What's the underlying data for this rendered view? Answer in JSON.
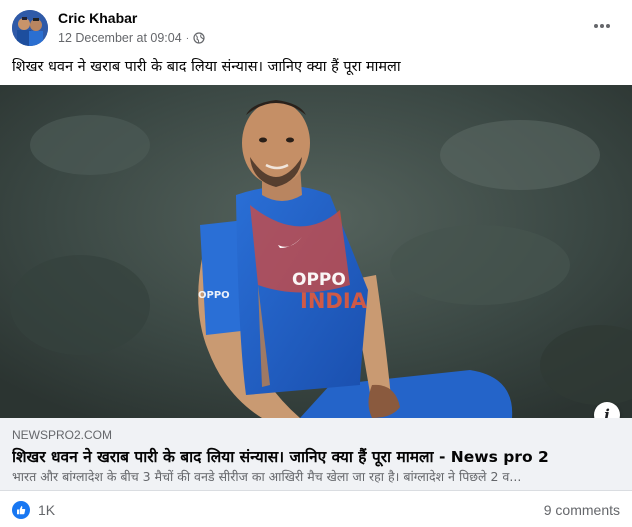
{
  "post": {
    "page_name": "Cric Khabar",
    "timestamp": "12 December at 09:04",
    "separator": "·",
    "privacy_icon": "globe-icon",
    "caption": "शिखर धवन ने खराब पारी के बाद लिया संन्यास। जानिए क्या हैं पूरा मामला",
    "more_icon": "more-horizontal-icon"
  },
  "link_preview": {
    "domain": "NEWSPRO2.COM",
    "title": "शिखर धवन ने खराब पारी के बाद लिया संन्यास। जानिए क्या हैं पूरा मामला",
    "title_separator": " - ",
    "site_name": "News pro 2",
    "description": "भारत और बांग्लादेश के बीच 3 मैचों की वनडे सीरीज का आखिरी मैच खेला जा रहा है। बांग्लादेश ने पिछले 2 व...",
    "info_label": "i"
  },
  "reactions": {
    "count": "1K",
    "comments": "9 comments",
    "like_color": "#1877f2"
  }
}
